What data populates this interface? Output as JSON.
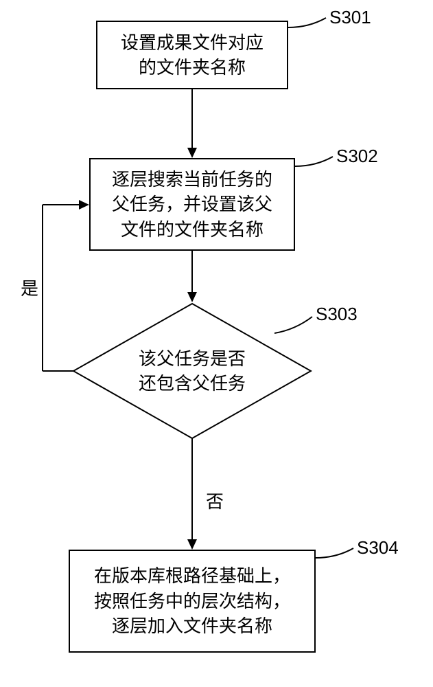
{
  "flowchart": {
    "nodes": {
      "s301": {
        "text": "设置成果文件对应\n的文件夹名称",
        "label": "S301"
      },
      "s302": {
        "text": "逐层搜索当前任务的\n父任务，并设置该父\n文件的文件夹名称",
        "label": "S302"
      },
      "s303": {
        "text": "该父任务是否\n还包含父任务",
        "label": "S303"
      },
      "s304": {
        "text": "在版本库根路径基础上，\n按照任务中的层次结构，\n逐层加入文件夹名称",
        "label": "S304"
      }
    },
    "edges": {
      "yes": "是",
      "no": "否"
    }
  }
}
